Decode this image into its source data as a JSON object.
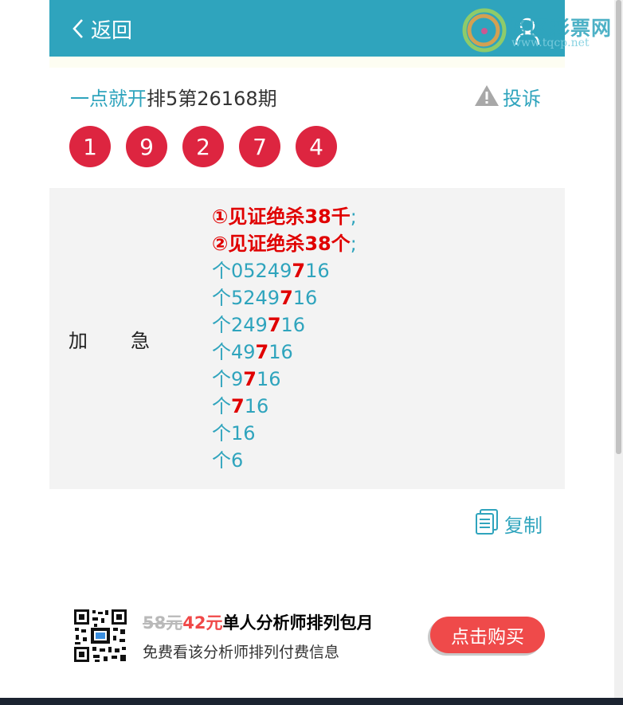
{
  "nav": {
    "back_label": "返回",
    "logo_text": "特区彩票网",
    "logo_url": "www.tqcp.net"
  },
  "header": {
    "brand": "一点就开",
    "title": "排5第26168期",
    "complain_label": "投诉"
  },
  "balls": [
    "1",
    "9",
    "2",
    "7",
    "4"
  ],
  "prediction": {
    "label_chars": [
      "加",
      "急"
    ],
    "kill_lines": [
      {
        "text": "①见证绝杀38千",
        "semi": ";"
      },
      {
        "text": "②见证绝杀38个",
        "semi": ";"
      }
    ],
    "lines": [
      {
        "pre": "个05249",
        "hl": "7",
        "post": "16"
      },
      {
        "pre": "个5249",
        "hl": "7",
        "post": "16"
      },
      {
        "pre": "个249",
        "hl": "7",
        "post": "16"
      },
      {
        "pre": "个49",
        "hl": "7",
        "post": "16"
      },
      {
        "pre": "个9",
        "hl": "7",
        "post": "16"
      },
      {
        "pre": "个",
        "hl": "7",
        "post": "16"
      },
      {
        "pre": "个16",
        "hl": "",
        "post": ""
      },
      {
        "pre": "个6",
        "hl": "",
        "post": ""
      }
    ]
  },
  "actions": {
    "copy_label": "复制"
  },
  "promo": {
    "old_price": "58元",
    "new_price": "42元",
    "title": "单人分析师排列包月",
    "desc": "免费看该分析师排列付费信息",
    "buy_label": "点击购买"
  },
  "colors": {
    "accent": "#2fa4bd",
    "ball": "#dd2540",
    "highlight": "#e00000",
    "buy": "#ef4a4a"
  }
}
